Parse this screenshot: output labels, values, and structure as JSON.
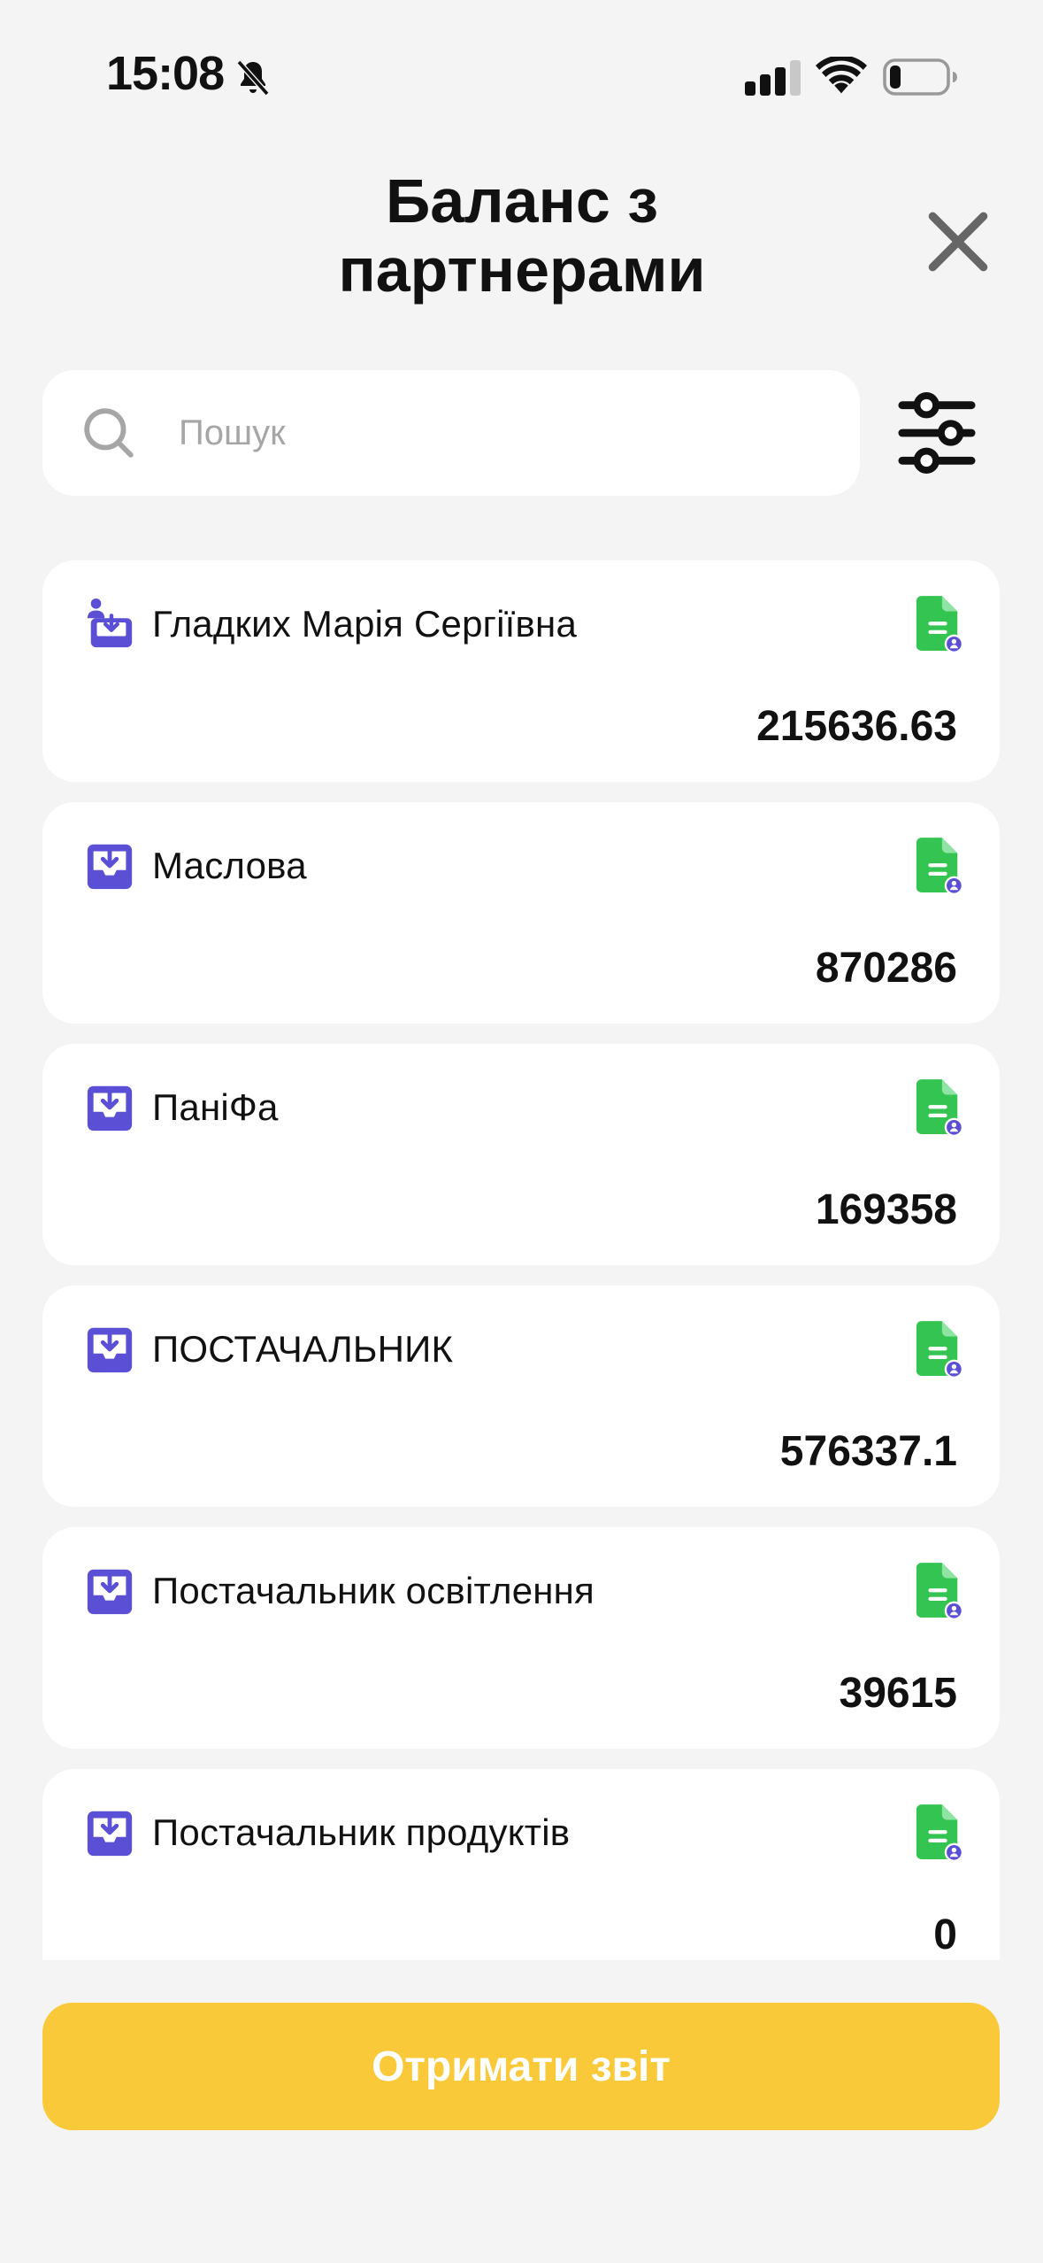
{
  "status_bar": {
    "time": "15:08",
    "icons": [
      "bell-slash-icon",
      "cellular-signal-icon",
      "wifi-icon",
      "battery-low-icon"
    ]
  },
  "header": {
    "title": "Баланс з\nпартнерами",
    "close_icon": "close-icon"
  },
  "search": {
    "placeholder": "Пошук",
    "value": "",
    "icon": "search-icon",
    "filter_icon": "sliders-icon"
  },
  "partners": [
    {
      "name": "Гладких Марія Сергіївна",
      "balance": "215636.63",
      "type_icon": "person-inbox-icon"
    },
    {
      "name": "Маслова",
      "balance": "870286",
      "type_icon": "inbox-download-icon"
    },
    {
      "name": "ПаніФа",
      "balance": "169358",
      "type_icon": "inbox-download-icon"
    },
    {
      "name": "ПОСТАЧАЛЬНИК",
      "balance": "576337.1",
      "type_icon": "inbox-download-icon"
    },
    {
      "name": "Постачальник освітлення",
      "balance": "39615",
      "type_icon": "inbox-download-icon"
    },
    {
      "name": "Постачальник продуктів",
      "balance": "0",
      "type_icon": "inbox-download-icon"
    }
  ],
  "footer": {
    "report_button": "Отримати звіт"
  },
  "colors": {
    "background": "#f4f4f4",
    "card": "#ffffff",
    "accent_yellow": "#f9c93a",
    "icon_purple": "#5b4fd6",
    "doc_green": "#33c452"
  }
}
